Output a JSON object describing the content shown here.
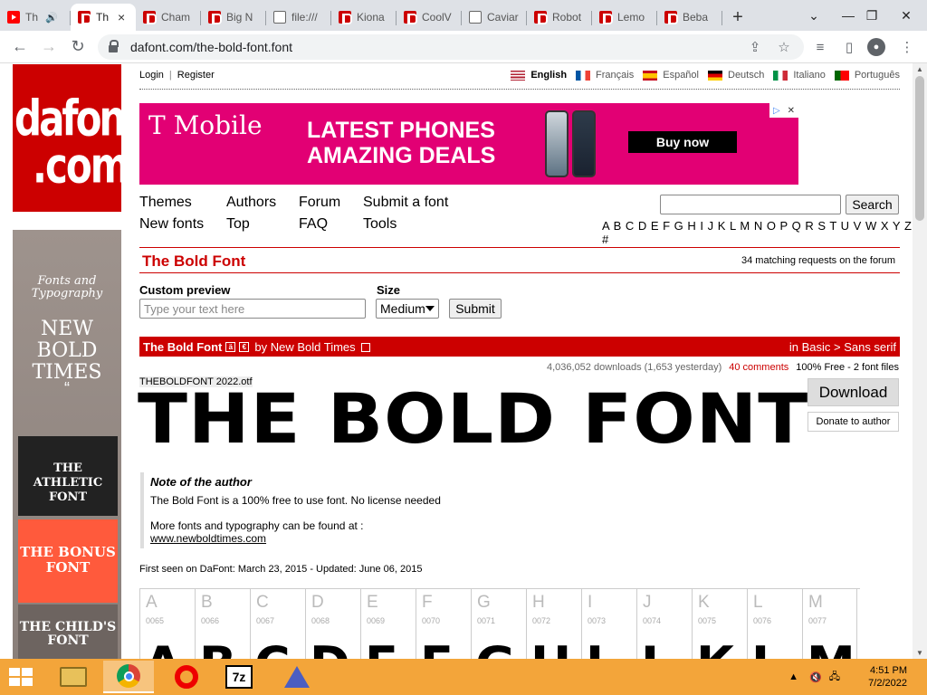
{
  "browser": {
    "tabs": [
      {
        "label": "Th",
        "icon": "youtube-icon",
        "active": false
      },
      {
        "label": "Th",
        "icon": "dafont-icon",
        "active": true
      },
      {
        "label": "Cham",
        "icon": "dafont-icon",
        "active": false
      },
      {
        "label": "Big N",
        "icon": "dafont-icon",
        "active": false
      },
      {
        "label": "file:///",
        "icon": "globe-icon",
        "active": false
      },
      {
        "label": "Kiona",
        "icon": "dafont-icon",
        "active": false
      },
      {
        "label": "CoolV",
        "icon": "dafont-icon",
        "active": false
      },
      {
        "label": "Caviar",
        "icon": "globe-icon",
        "active": false
      },
      {
        "label": "Robot",
        "icon": "dafont-icon",
        "active": false
      },
      {
        "label": "Lemo",
        "icon": "dafont-icon",
        "active": false
      },
      {
        "label": "Beba",
        "icon": "dafont-icon",
        "active": false
      }
    ],
    "tab_close": "×",
    "new_tab": "+",
    "url": "dafont.com/the-bold-font.font"
  },
  "header": {
    "logo_line1": "dafont",
    "logo_line2": ".com",
    "login": "Login",
    "register": "Register",
    "languages": [
      "English",
      "Français",
      "Español",
      "Deutsch",
      "Italiano",
      "Português"
    ],
    "selected_language": "English"
  },
  "ad": {
    "brand": "T Mobile",
    "headline1": "LATEST PHONES",
    "headline2": "AMAZING DEALS",
    "cta": "Buy now",
    "brand_color": "#e20074"
  },
  "side_ad": {
    "tagline": "Fonts and Typography",
    "title": "NEW BOLD TIMES",
    "quote": "“",
    "box1": "THE ATHLETIC FONT",
    "box2": "THE BONUS FONT",
    "box3": "THE CHILD'S FONT"
  },
  "nav": {
    "themes": "Themes",
    "authors": "Authors",
    "forum": "Forum",
    "submit_font": "Submit a font",
    "new_fonts": "New fonts",
    "top": "Top",
    "faq": "FAQ",
    "tools": "Tools",
    "search_button": "Search",
    "alphabet": "A B C D E F G H I J K L M N O P Q R S T U V W X Y Z #"
  },
  "font": {
    "title": "The Bold Font",
    "forum_requests": "34 matching requests on the forum",
    "custom_preview_label": "Custom preview",
    "preview_placeholder": "Type your text here",
    "size_label": "Size",
    "size_value": "Medium",
    "submit": "Submit",
    "bar_name": "The Bold Font",
    "bar_by": "by New Bold Times",
    "category": "in Basic > Sans serif",
    "downloads": "4,036,052 downloads (1,653 yesterday)",
    "comments": "40 comments",
    "license": "100% Free - 2 font files",
    "filename": "THEBOLDFONT 2022.otf",
    "preview_text": "THE BOLD FONT",
    "download": "Download",
    "donate": "Donate to author",
    "note_title": "Note of the author",
    "note_line1": "The Bold Font is a 100% free to use font. No license needed",
    "note_line2": "More fonts and typography can be found at :",
    "note_link": "www.newboldtimes.com",
    "first_seen": "First seen on DaFont: March 23, 2015 - Updated: June 06, 2015"
  },
  "charmap": [
    {
      "ch": "A",
      "code": "0065"
    },
    {
      "ch": "B",
      "code": "0066"
    },
    {
      "ch": "C",
      "code": "0067"
    },
    {
      "ch": "D",
      "code": "0068"
    },
    {
      "ch": "E",
      "code": "0069"
    },
    {
      "ch": "F",
      "code": "0070"
    },
    {
      "ch": "G",
      "code": "0071"
    },
    {
      "ch": "H",
      "code": "0072"
    },
    {
      "ch": "I",
      "code": "0073"
    },
    {
      "ch": "J",
      "code": "0074"
    },
    {
      "ch": "K",
      "code": "0075"
    },
    {
      "ch": "L",
      "code": "0076"
    },
    {
      "ch": "M",
      "code": "0077"
    }
  ],
  "taskbar": {
    "time": "4:51 PM",
    "date": "7/2/2022",
    "color": "#f3a53a"
  }
}
